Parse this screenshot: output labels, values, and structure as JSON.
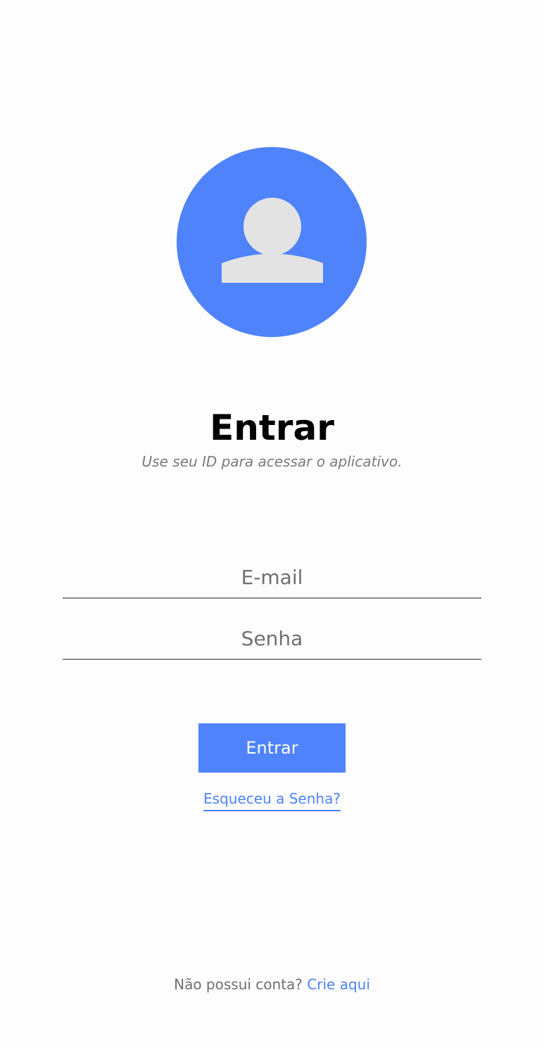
{
  "colors": {
    "accent": "#4f83fc",
    "avatar_figure": "#e3e3e3",
    "background": "#fdfdfd",
    "muted_text": "#6f6f6f"
  },
  "avatar": {
    "icon": "user-avatar-icon"
  },
  "header": {
    "title": "Entrar",
    "subtitle": "Use seu ID para acessar o aplicativo."
  },
  "form": {
    "email_placeholder": "E-mail",
    "email_value": "",
    "password_placeholder": "Senha",
    "password_value": "",
    "submit_label": "Entrar",
    "forgot_label": "Esqueceu a Senha?"
  },
  "footer": {
    "prompt": "Não possui conta?",
    "link_label": "Crie aqui"
  }
}
